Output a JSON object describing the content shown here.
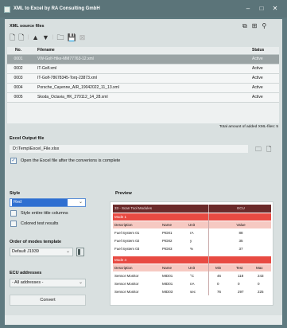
{
  "window": {
    "title": "XML to Excel by RA Consulting GmbH"
  },
  "xml_section": {
    "title": "XML source files",
    "columns": [
      "No.",
      "Filename",
      "Status"
    ],
    "rows": [
      {
        "no": "0001",
        "filename": "VW-Golf-Hike-MM77763-12.xml",
        "status": "Active"
      },
      {
        "no": "0002",
        "filename": "IT-Golf.xml",
        "status": "Active"
      },
      {
        "no": "0003",
        "filename": "IT-Golf-78678345-Torq-23873.xml",
        "status": "Active"
      },
      {
        "no": "0004",
        "filename": "Porsche_Cayenne_AIR_19042022_11_13.xml",
        "status": "Active"
      },
      {
        "no": "0005",
        "filename": "Skoda_Octavia_HK_270112_14_28.xml",
        "status": "Active"
      }
    ],
    "selected_index": 0,
    "total_text": "Total amount of added XML-files: 5"
  },
  "output": {
    "title": "Excel Output file",
    "path": "D:\\Temp\\Excel_File.xlsx",
    "open_after": "Open the Excel file after the converions is complete",
    "open_after_checked": true
  },
  "style": {
    "title": "Style",
    "selected": "Red",
    "entire_title_label": "Style entire title columns",
    "entire_title_checked": false,
    "colored_results_label": "Colored test results",
    "colored_results_checked": false
  },
  "order": {
    "title": "Order of modes template",
    "selected": "Default J1939"
  },
  "ecu": {
    "title": "ECU addresses",
    "selected": "- All addresses -"
  },
  "convert_label": "Convert",
  "preview": {
    "title": "Preview",
    "header_left": "33 - Scan Tool Modules",
    "header_right": "ECU",
    "mode1": "Mode 1",
    "mode1_cols": [
      "Description",
      "Name",
      "Unit",
      "Value"
    ],
    "mode1_rows": [
      [
        "Fuel System 01",
        "PID01",
        "rA",
        "88"
      ],
      [
        "Fuel System 02",
        "PID02",
        "y",
        "35"
      ],
      [
        "Fuel System 03",
        "PID03",
        "%",
        "37"
      ]
    ],
    "mode4": "Mode 4",
    "mode4_cols": [
      "Description",
      "Name",
      "Unit",
      "Min",
      "Test",
      "Max"
    ],
    "mode4_rows": [
      [
        "Sensor Monitor",
        "MID01",
        "°C",
        "46",
        "118",
        "243"
      ],
      [
        "Sensor Monitor",
        "MID01",
        "nA",
        "0",
        "0",
        "0"
      ],
      [
        "Sensor Monitor",
        "MID03",
        "sec",
        "76",
        "297",
        "225"
      ]
    ]
  },
  "colors": {
    "frame": "#5f7a80",
    "client": "#d9e0e0",
    "preview_header": "#6b2a2a",
    "preview_mode": "#e84a42",
    "preview_cols": "#f6c9c2",
    "selection": "#2f6fd1"
  }
}
